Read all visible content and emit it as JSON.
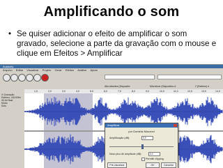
{
  "slide": {
    "title": "Amplificando o som",
    "bullet": "Se quiser adicionar o efeito de amplificar o som gravado, selecione a parte da gravação com o mouse e clique em Efeitos > Amplificar"
  },
  "app": {
    "window_title": "Audacity",
    "menu": [
      "Arquivo",
      "Editar",
      "Visualizar",
      "Projeto",
      "Gerar",
      "Efeitos",
      "Análise",
      "Ajuda"
    ],
    "devices": {
      "output": "Alto-falantes (Dispositiv",
      "input": "Microfone (Dispositivo d",
      "channels": "2 (Estéreo) e"
    },
    "ruler_ticks": [
      "1,0",
      "2,0",
      "3,0",
      "4,0",
      "5,0",
      "6,0",
      "7,0",
      "8,0",
      "9,0",
      "10,0",
      "11,0",
      "12,0",
      "13,0",
      "14,0"
    ],
    "track": {
      "name": "X Gravação",
      "info1": "Estéreo, 44100Hz",
      "info2": "32-bit float",
      "mute": "Mudo",
      "solo": "Solo",
      "scale": [
        "1,0",
        "0,5",
        "0,0",
        "-0,5",
        "-1,0",
        "1,0",
        "0,5",
        "0,0",
        "-0,5",
        "-1,0"
      ]
    }
  },
  "dialog": {
    "title": "Amplificar",
    "subtitle": "por Dominic Mazzoni",
    "amp_label": "Amplificação (dB):",
    "amp_value": "9,9",
    "peak_label": "Novo pico de amplitude (dB):",
    "peak_value": "0,0",
    "clip_label": "Permitir clipping",
    "btn_preview": "Pré-visualizar",
    "btn_ok": "OK",
    "btn_cancel": "Cancelar"
  }
}
